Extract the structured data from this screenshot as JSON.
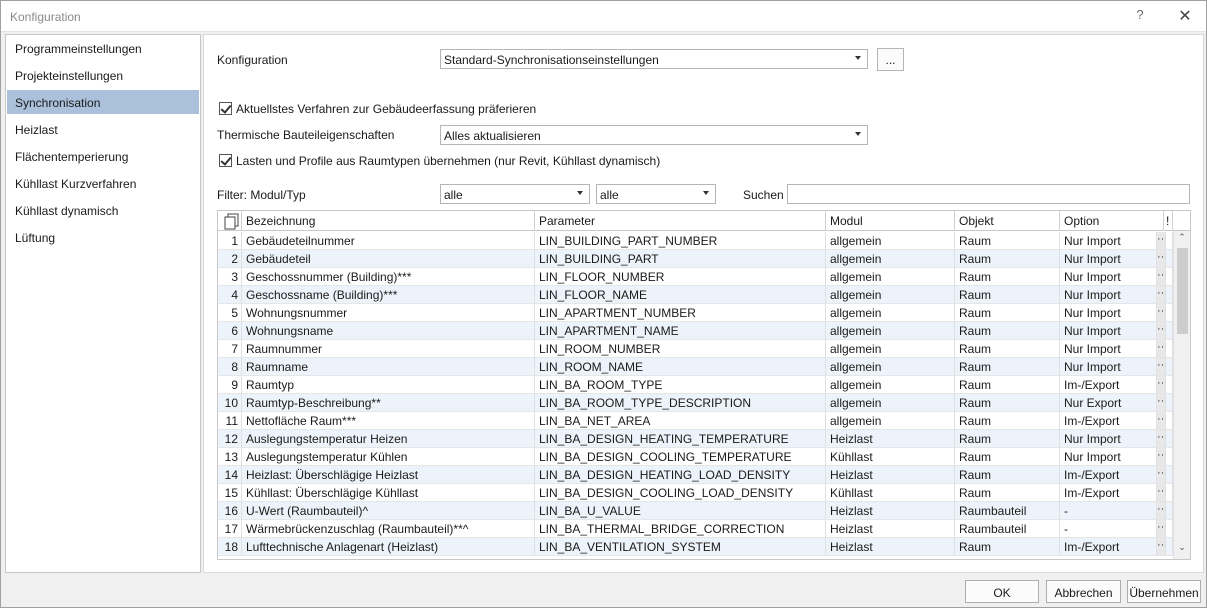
{
  "window": {
    "title": "Konfiguration",
    "help_label": "?",
    "close_label": "✕"
  },
  "sidebar": {
    "items": [
      {
        "label": "Programmeinstellungen"
      },
      {
        "label": "Projekteinstellungen"
      },
      {
        "label": "Synchronisation",
        "active": true
      },
      {
        "label": "Heizlast"
      },
      {
        "label": "Flächentemperierung"
      },
      {
        "label": "Kühllast Kurzverfahren"
      },
      {
        "label": "Kühllast dynamisch"
      },
      {
        "label": "Lüftung"
      }
    ]
  },
  "settings": {
    "konfiguration_label": "Konfiguration",
    "konfiguration_value": "Standard-Synchronisationseinstellungen",
    "more_button": "...",
    "checkbox1_label": "Aktuellstes Verfahren zur Gebäudeerfassung präferieren",
    "checkbox1_checked": true,
    "thermisch_label": "Thermische Bauteileigenschaften",
    "thermisch_value": "Alles aktualisieren",
    "checkbox2_label": "Lasten und Profile aus Raumtypen übernehmen (nur Revit, Kühllast dynamisch)",
    "checkbox2_checked": true,
    "filter_label": "Filter: Modul/Typ",
    "filter_modul_value": "alle",
    "filter_typ_value": "alle",
    "search_label": "Suchen",
    "search_value": ""
  },
  "table": {
    "columns": [
      "Bezeichnung",
      "Parameter",
      "Modul",
      "Objekt",
      "Option",
      "!"
    ],
    "rows": [
      {
        "n": "1",
        "bez": "Gebäudeteilnummer",
        "param": "LIN_BUILDING_PART_NUMBER",
        "modul": "allgemein",
        "objekt": "Raum",
        "option": "Nur Import"
      },
      {
        "n": "2",
        "bez": "Gebäudeteil",
        "param": "LIN_BUILDING_PART",
        "modul": "allgemein",
        "objekt": "Raum",
        "option": "Nur Import"
      },
      {
        "n": "3",
        "bez": "Geschossnummer (Building)***",
        "param": "LIN_FLOOR_NUMBER",
        "modul": "allgemein",
        "objekt": "Raum",
        "option": "Nur Import"
      },
      {
        "n": "4",
        "bez": "Geschossname (Building)***",
        "param": "LIN_FLOOR_NAME",
        "modul": "allgemein",
        "objekt": "Raum",
        "option": "Nur Import"
      },
      {
        "n": "5",
        "bez": "Wohnungsnummer",
        "param": "LIN_APARTMENT_NUMBER",
        "modul": "allgemein",
        "objekt": "Raum",
        "option": "Nur Import"
      },
      {
        "n": "6",
        "bez": "Wohnungsname",
        "param": "LIN_APARTMENT_NAME",
        "modul": "allgemein",
        "objekt": "Raum",
        "option": "Nur Import"
      },
      {
        "n": "7",
        "bez": "Raumnummer",
        "param": "LIN_ROOM_NUMBER",
        "modul": "allgemein",
        "objekt": "Raum",
        "option": "Nur Import"
      },
      {
        "n": "8",
        "bez": "Raumname",
        "param": "LIN_ROOM_NAME",
        "modul": "allgemein",
        "objekt": "Raum",
        "option": "Nur Import"
      },
      {
        "n": "9",
        "bez": "Raumtyp",
        "param": "LIN_BA_ROOM_TYPE",
        "modul": "allgemein",
        "objekt": "Raum",
        "option": "Im-/Export"
      },
      {
        "n": "10",
        "bez": "Raumtyp-Beschreibung**",
        "param": "LIN_BA_ROOM_TYPE_DESCRIPTION",
        "modul": "allgemein",
        "objekt": "Raum",
        "option": "Nur Export"
      },
      {
        "n": "11",
        "bez": "Nettofläche Raum***",
        "param": "LIN_BA_NET_AREA",
        "modul": "allgemein",
        "objekt": "Raum",
        "option": "Im-/Export"
      },
      {
        "n": "12",
        "bez": "Auslegungstemperatur Heizen",
        "param": "LIN_BA_DESIGN_HEATING_TEMPERATURE",
        "modul": "Heizlast",
        "objekt": "Raum",
        "option": "Nur Import"
      },
      {
        "n": "13",
        "bez": "Auslegungstemperatur Kühlen",
        "param": "LIN_BA_DESIGN_COOLING_TEMPERATURE",
        "modul": "Kühllast",
        "objekt": "Raum",
        "option": "Nur Import"
      },
      {
        "n": "14",
        "bez": "Heizlast: Überschlägige Heizlast",
        "param": "LIN_BA_DESIGN_HEATING_LOAD_DENSITY",
        "modul": "Heizlast",
        "objekt": "Raum",
        "option": "Im-/Export"
      },
      {
        "n": "15",
        "bez": "Kühllast: Überschlägige Kühllast",
        "param": "LIN_BA_DESIGN_COOLING_LOAD_DENSITY",
        "modul": "Kühllast",
        "objekt": "Raum",
        "option": "Im-/Export"
      },
      {
        "n": "16",
        "bez": "U-Wert (Raumbauteil)^",
        "param": "LIN_BA_U_VALUE",
        "modul": "Heizlast",
        "objekt": "Raumbauteil",
        "option": "-"
      },
      {
        "n": "17",
        "bez": "Wärmebrückenzuschlag (Raumbauteil)**^",
        "param": "LIN_BA_THERMAL_BRIDGE_CORRECTION",
        "modul": "Heizlast",
        "objekt": "Raumbauteil",
        "option": "-"
      },
      {
        "n": "18",
        "bez": "Lufttechnische Anlagenart (Heizlast)",
        "param": "LIN_BA_VENTILATION_SYSTEM",
        "modul": "Heizlast",
        "objekt": "Raum",
        "option": "Im-/Export"
      }
    ],
    "row_button": "···",
    "scroll_up": "⌃",
    "scroll_down": "⌄"
  },
  "footer": {
    "ok": "OK",
    "cancel": "Abbrechen",
    "apply": "Übernehmen"
  }
}
